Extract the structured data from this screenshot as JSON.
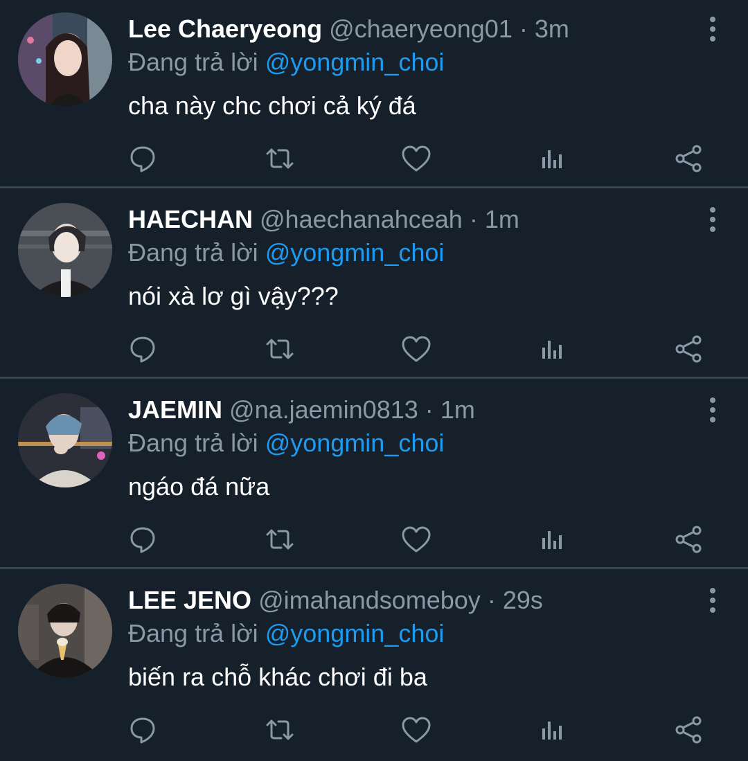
{
  "replies": [
    {
      "name": "Lee Chaeryeong",
      "handle": "@chaeryeong01",
      "separator": "·",
      "time": "3m",
      "reply_label": "Đang trả lời",
      "reply_to": "@yongmin_choi",
      "text": "cha này chc chơi cả ký đá"
    },
    {
      "name": "HAECHAN",
      "handle": "@haechanahceah",
      "separator": "·",
      "time": "1m",
      "reply_label": "Đang trả lời",
      "reply_to": "@yongmin_choi",
      "text": "nói xà lơ gì vậy???"
    },
    {
      "name": "JAEMIN",
      "handle": "@na.jaemin0813",
      "separator": "·",
      "time": "1m",
      "reply_label": "Đang trả lời",
      "reply_to": "@yongmin_choi",
      "text": "ngáo đá nữa"
    },
    {
      "name": "LEE JENO",
      "handle": "@imahandsomeboy",
      "separator": "·",
      "time": "29s",
      "reply_label": "Đang trả lời",
      "reply_to": "@yongmin_choi",
      "text": "biến ra chỗ khác chơi đi ba"
    }
  ],
  "icons": {
    "reply": "reply-icon",
    "retweet": "retweet-icon",
    "like": "heart-icon",
    "stats": "stats-icon",
    "share": "share-icon",
    "more": "more-vertical-icon"
  },
  "colors": {
    "background": "#15202b",
    "divider": "#38444d",
    "secondary_text": "#8b98a5",
    "mention": "#1d9bf0",
    "primary_text": "#ffffff"
  }
}
